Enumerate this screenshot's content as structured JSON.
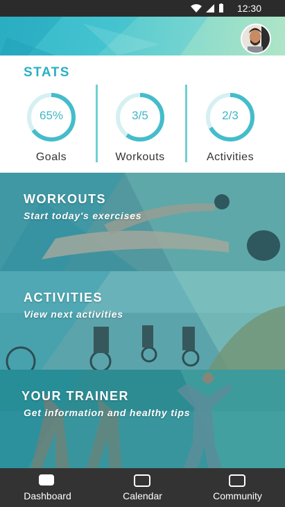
{
  "status_bar": {
    "time": "12:30"
  },
  "stats": {
    "title": "STATS",
    "items": [
      {
        "value_text": "65%",
        "label": "Goals",
        "progress": 0.65
      },
      {
        "value_text": "3/5",
        "label": "Workouts",
        "progress": 0.6
      },
      {
        "value_text": "2/3",
        "label": "Activities",
        "progress": 0.67
      }
    ]
  },
  "cards": [
    {
      "title": "WORKOUTS",
      "subtitle": "Start today's exercises"
    },
    {
      "title": "ACTIVITIES",
      "subtitle": "View next activities"
    },
    {
      "title": "YOUR TRAINER",
      "subtitle": "Get information and healthy tips"
    }
  ],
  "nav": {
    "items": [
      {
        "label": "Dashboard",
        "icon": "dashboard-icon",
        "active": true
      },
      {
        "label": "Calendar",
        "icon": "calendar-icon",
        "active": false
      },
      {
        "label": "Community",
        "icon": "community-icon",
        "active": false
      }
    ]
  },
  "colors": {
    "accent": "#2bb0c3",
    "ring_track": "#d6f0f2",
    "ring_fill": "#45bccb",
    "nav_bg": "#333333"
  }
}
